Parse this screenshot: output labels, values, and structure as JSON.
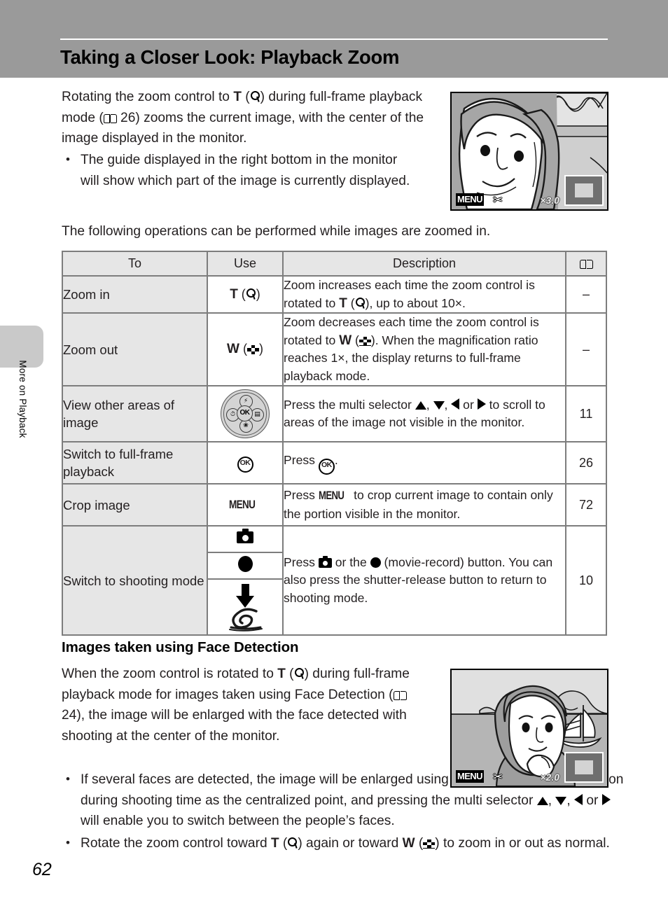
{
  "header": {
    "title": "Taking a Closer Look: Playback Zoom"
  },
  "sidebar": {
    "tab_label": "More on Playback",
    "page_number": "62"
  },
  "intro": {
    "paragraph_parts": {
      "p1": "Rotating the zoom control to ",
      "t": "T",
      "p2": " (",
      "p3": ") during full-frame playback mode (",
      "p4": " 26) zooms the current image, with the center of the image displayed in the monitor."
    },
    "bullet_1": "The guide displayed in the right bottom in the monitor will show which part of the image is currently displayed.",
    "lead_in": "The following operations can be performed while images are zoomed in."
  },
  "monitor_top": {
    "menu_label": "MENU",
    "scissors_icon": "scissors-icon",
    "zoom_ratio": "×3.0",
    "guide_icon": "zoom-guide-icon"
  },
  "monitor_bottom": {
    "menu_label": "MENU",
    "scissors_icon": "scissors-icon",
    "zoom_ratio": "×2.0",
    "guide_icon": "zoom-guide-icon"
  },
  "table": {
    "headers": {
      "to": "To",
      "use": "Use",
      "description": "Description",
      "page": "book-icon"
    },
    "rows": [
      {
        "to": "Zoom in",
        "use_label": "T",
        "use_icon": "magnify-icon",
        "desc_a": "Zoom increases each time the zoom control is rotated to ",
        "desc_t": "T",
        "desc_b": " (",
        "desc_c": "), up to about 10×.",
        "page": "–"
      },
      {
        "to": "Zoom out",
        "use_label": "W",
        "use_icon": "wide-view-icon",
        "desc_a": "Zoom decreases each time the zoom control is rotated to ",
        "desc_t": "W",
        "desc_b": " (",
        "desc_c": "). When the magnification ratio reaches 1×, the display returns to full-frame playback mode.",
        "page": "–"
      },
      {
        "to": "View other areas of image",
        "use_icon": "multi-selector-icon",
        "desc_a": "Press the multi selector ",
        "desc_b": ", ",
        "desc_c": ", ",
        "desc_d": " or ",
        "desc_e": " to scroll to areas of the image not visible in the monitor.",
        "page": "11"
      },
      {
        "to": "Switch to full-frame playback",
        "use_icon": "ok-button-icon",
        "use_label": "OK",
        "desc_a": "Press ",
        "desc_b": ".",
        "page": "26"
      },
      {
        "to": "Crop image",
        "use_label": "MENU",
        "desc_a": "Press ",
        "desc_menu": "MENU",
        "desc_b": " to crop current image to contain only the portion visible in the monitor.",
        "page": "72"
      },
      {
        "to": "Switch to shooting mode",
        "use_icons": [
          "camera-button-icon",
          "movie-record-icon",
          "shutter-release-icon"
        ],
        "desc_a": "Press ",
        "desc_b": " or the ",
        "desc_c": " (movie-record) button. You can also press the shutter-release button to return to shooting mode.",
        "page": "10"
      }
    ]
  },
  "face_section": {
    "heading": "Images taken using Face Detection",
    "paragraph": {
      "p1": "When the zoom control is rotated to ",
      "t": "T",
      "p2": " (",
      "p3": ") during full-frame playback mode for images taken using Face Detection (",
      "p4": " 24), the image will be enlarged with the face detected with shooting at the center of the monitor."
    },
    "bullet_1": {
      "a": "If several faces are detected, the image will be enlarged using the face that was focused on during shooting time as the centralized point, and pressing the multi selector ",
      "b": ", ",
      "c": ", ",
      "d": " or ",
      "e": " will enable you to switch between the people’s faces."
    },
    "bullet_2": {
      "a": "Rotate the zoom control toward ",
      "t": "T",
      "b": " (",
      "c": ") again or toward ",
      "w": "W",
      "d": " (",
      "e": ") to zoom in or out as normal."
    }
  },
  "colors": {
    "banner": "#9a9a9a",
    "table_border": "#7d7d7d",
    "table_header_fill": "#e6e6e6",
    "tab_fill": "#c9c9c9",
    "monitor_bg": "#c4c4c4"
  }
}
